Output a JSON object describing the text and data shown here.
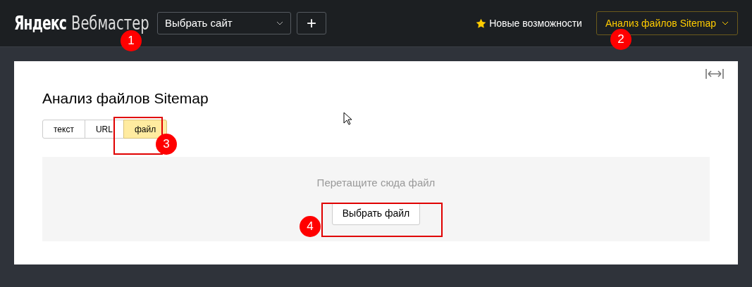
{
  "header": {
    "logo_bold": "Яндекс",
    "logo_light": "Вебмастер",
    "site_select": {
      "value": "Выбрать сайт"
    },
    "add_button": "+",
    "news_link": "Новые возможности",
    "tool_menu": "Анализ файлов Sitemap"
  },
  "page": {
    "title": "Анализ файлов Sitemap",
    "tabs": [
      {
        "label": "текст",
        "selected": false
      },
      {
        "label": "URL",
        "selected": false
      },
      {
        "label": "файл",
        "selected": true
      }
    ],
    "drop_zone": {
      "hint": "Перетащите сюда файл",
      "button": "Выбрать файл"
    }
  },
  "callouts": [
    {
      "number": "1",
      "framed": false
    },
    {
      "number": "2",
      "framed": false
    },
    {
      "number": "3",
      "framed": true
    },
    {
      "number": "4",
      "framed": true
    }
  ]
}
